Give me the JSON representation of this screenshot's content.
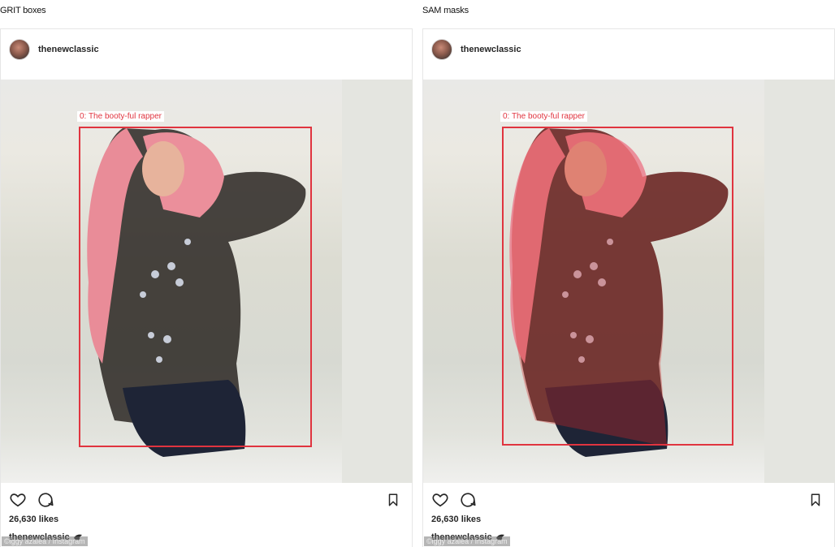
{
  "panels": [
    {
      "caption": "GRIT boxes",
      "username": "thenewclassic",
      "box_label": "0: The booty-ful rapper",
      "likes": "26,630 likes",
      "caption_username": "thenewclassic",
      "credit": "©iggy azalea / Instagram",
      "mask": false
    },
    {
      "caption": "SAM masks",
      "username": "thenewclassic",
      "box_label": "0: The booty-ful rapper",
      "likes": "26,630 likes",
      "caption_username": "thenewclassic",
      "credit": "©iggy azalea / Instagram",
      "mask": true
    }
  ],
  "icons": {
    "like": "heart-icon",
    "comment": "comment-icon",
    "save": "bookmark-icon",
    "caption_emoji": "bird-emoji-icon"
  },
  "colors": {
    "box": "#e0343f",
    "mask": "#d22828"
  }
}
